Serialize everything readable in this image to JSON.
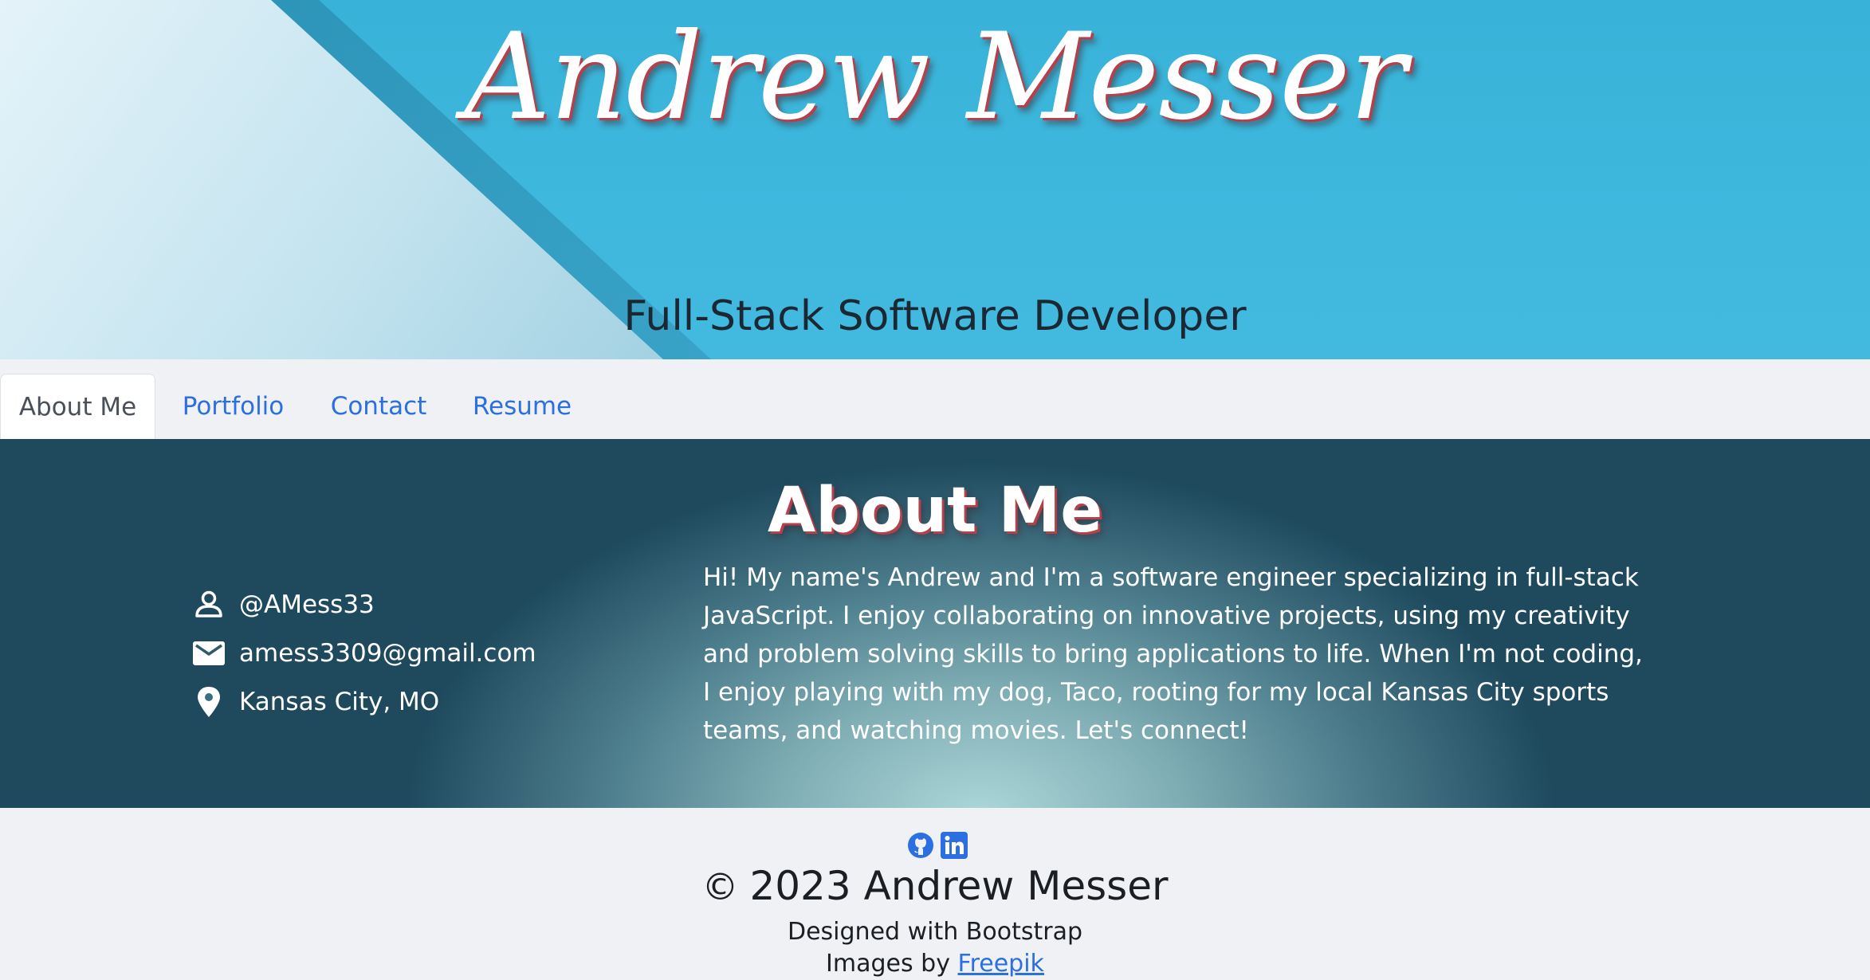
{
  "header": {
    "title": "Andrew Messer",
    "subtitle": "Full-Stack Software Developer"
  },
  "nav": {
    "tabs": [
      {
        "label": "About Me",
        "active": true
      },
      {
        "label": "Portfolio",
        "active": false
      },
      {
        "label": "Contact",
        "active": false
      },
      {
        "label": "Resume",
        "active": false
      }
    ]
  },
  "about": {
    "heading": "About Me",
    "contacts": [
      {
        "icon": "person-icon",
        "text": "@AMess33"
      },
      {
        "icon": "envelope-icon",
        "text": "amess3309@gmail.com"
      },
      {
        "icon": "map-pin-icon",
        "text": "Kansas City, MO"
      }
    ],
    "bio": "Hi! My name's Andrew and I'm a software engineer specializing in full-stack JavaScript. I enjoy collaborating on innovative projects, using my creativity and problem solving skills to bring applications to life. When I'm not coding, I enjoy playing with my dog, Taco, rooting for my local Kansas City sports teams, and watching movies. Let's connect!"
  },
  "footer": {
    "social": [
      "github-icon",
      "linkedin-icon"
    ],
    "copyright_symbol": "©",
    "copyright": "2023 Andrew Messer",
    "designed_with": "Designed with Bootstrap",
    "images_by_prefix": "Images by",
    "images_by_link": "Freepik"
  },
  "colors": {
    "link": "#2b6fe0",
    "hero_blue": "#3fb8de",
    "title_shadow": "#b3404a",
    "about_dark": "#1f4a5e"
  }
}
